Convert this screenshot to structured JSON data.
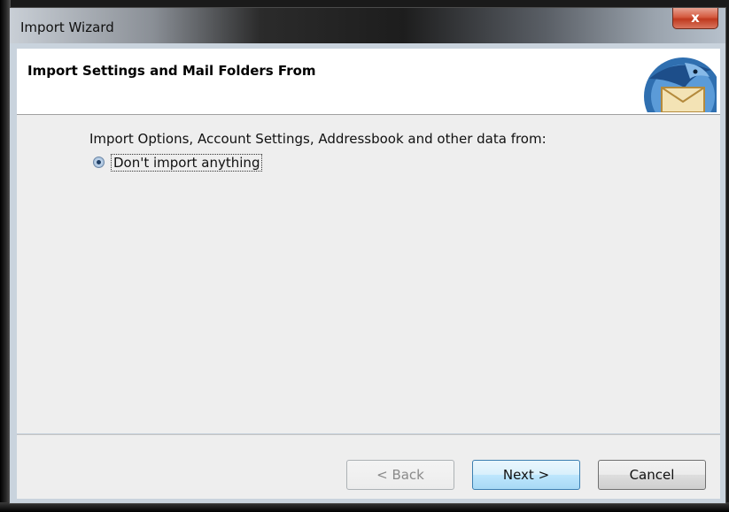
{
  "window": {
    "title": "Import Wizard",
    "close_label": "x"
  },
  "header": {
    "title": "Import Settings and Mail Folders From",
    "logo_icon": "thunderbird-logo-icon"
  },
  "content": {
    "prompt": "Import Options, Account Settings, Addressbook and other data from:",
    "options": [
      {
        "label": "Don't import anything",
        "selected": true
      }
    ]
  },
  "buttons": {
    "back_label": "< Back",
    "next_label": "Next >",
    "cancel_label": "Cancel"
  },
  "colors": {
    "close_button": "#c0391f",
    "default_button_border": "#3c7fb1"
  }
}
